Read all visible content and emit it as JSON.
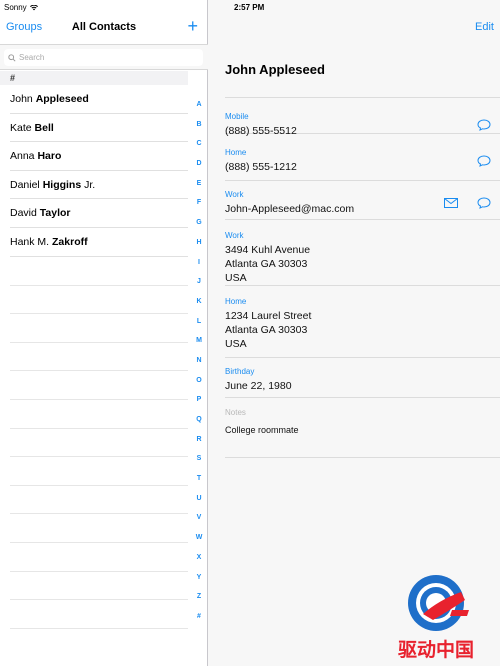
{
  "status": {
    "carrier": "Sonny",
    "time": "2:57 PM"
  },
  "left_nav": {
    "groups_label": "Groups",
    "title": "All Contacts",
    "add_label": "+"
  },
  "search": {
    "placeholder": "Search"
  },
  "section": {
    "label": "#"
  },
  "contacts": [
    {
      "first": "John ",
      "last": "Appleseed",
      "suffix": ""
    },
    {
      "first": "Kate ",
      "last": "Bell",
      "suffix": ""
    },
    {
      "first": "Anna ",
      "last": "Haro",
      "suffix": ""
    },
    {
      "first": "Daniel ",
      "last": "Higgins",
      "suffix": " Jr."
    },
    {
      "first": "David ",
      "last": "Taylor",
      "suffix": ""
    },
    {
      "first": "Hank M. ",
      "last": "Zakroff",
      "suffix": ""
    }
  ],
  "index_letters": [
    "A",
    "B",
    "C",
    "D",
    "E",
    "F",
    "G",
    "H",
    "I",
    "J",
    "K",
    "L",
    "M",
    "N",
    "O",
    "P",
    "Q",
    "R",
    "S",
    "T",
    "U",
    "V",
    "W",
    "X",
    "Y",
    "Z",
    "#"
  ],
  "detail": {
    "edit_label": "Edit",
    "name": "John Appleseed",
    "mobile_label": "Mobile",
    "mobile_value": "(888) 555-5512",
    "home_phone_label": "Home",
    "home_phone_value": "(888) 555-1212",
    "work_email_label": "Work",
    "work_email_value": "John-Appleseed@mac.com",
    "work_address_label": "Work",
    "work_address_line1": "3494 Kuhl Avenue",
    "work_address_line2": "Atlanta GA 30303",
    "work_address_line3": "USA",
    "home_address_label": "Home",
    "home_address_line1": "1234 Laurel Street",
    "home_address_line2": "Atlanta GA 30303",
    "home_address_line3": "USA",
    "birthday_label": "Birthday",
    "birthday_value": "June 22, 1980",
    "notes_label": "Notes",
    "notes_value": "College roommate"
  },
  "watermark": {
    "text": "驱动中国"
  },
  "colors": {
    "accent": "#1a8cf0",
    "watermark_red": "#e8222e",
    "watermark_blue": "#1f6fc9"
  },
  "icons": [
    "wifi-icon",
    "search-icon",
    "message-icon",
    "mail-icon"
  ]
}
